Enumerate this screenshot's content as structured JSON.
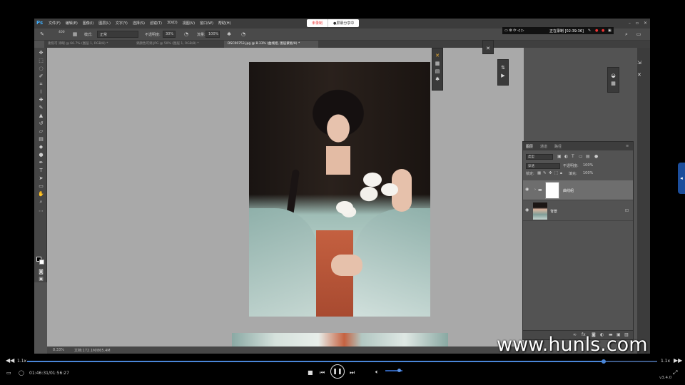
{
  "photoshop": {
    "logo": "Ps",
    "menu": [
      "文件(F)",
      "编辑(E)",
      "图像(I)",
      "图层(L)",
      "文字(Y)",
      "选择(S)",
      "滤镜(T)",
      "3D(D)",
      "视图(V)",
      "窗口(W)",
      "帮助(H)"
    ],
    "recording_pill": {
      "left": "未录制",
      "right": "●屏幕分享中"
    },
    "window_controls": [
      "–",
      "▫",
      "✕"
    ],
    "options": {
      "mode_label": "模式:",
      "mode_value": "正常",
      "opacity_label": "不透明度:",
      "opacity_value": "30%",
      "flow_label": "流量:",
      "flow_value": "100%",
      "brush_size": "400"
    },
    "tabs": [
      "柔焦可 添眼 @ 66.7% (图层 1, RGB/8) *",
      "调颜色可调.JPG @ 50% (图层 1, RGB/8) *",
      "DSC00753.jpg @ 8.33% (曲线组, 图层蒙板/8) *"
    ],
    "status": {
      "zoom": "8.33%",
      "doc": "文档:172.1M/865.4M"
    },
    "recorder": {
      "text": "正在录制 [02:39:36]"
    }
  },
  "layers_panel": {
    "tabs": [
      "图层",
      "通道",
      "路径"
    ],
    "filter_label": "类型",
    "blend_mode": "穿透",
    "opacity_label": "不透明度:",
    "opacity_value": "100%",
    "lock_label": "锁定:",
    "fill_label": "填充:",
    "fill_value": "100%",
    "layers": [
      {
        "name": "曲线组",
        "selected": true
      },
      {
        "name": "背景",
        "selected": false
      }
    ]
  },
  "watermark": "www.hunls.com",
  "player": {
    "speed_left": "1.1x",
    "speed_right": "1.1x",
    "timecode": "01:46:31/01:56:27",
    "progress_fraction": 0.915,
    "volume_fraction": 0.8,
    "version": "v3.4.0"
  }
}
